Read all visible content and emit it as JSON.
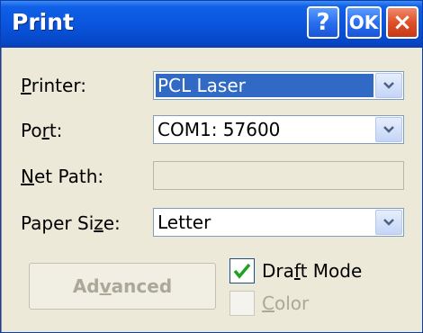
{
  "window": {
    "title": "Print"
  },
  "titlebar": {
    "help_label": "?",
    "ok_label": "OK",
    "close_label": "×"
  },
  "printer": {
    "label_before": "",
    "label_mnemonic": "P",
    "label_after": "rinter:",
    "value": "PCL Laser"
  },
  "port": {
    "label_before": "Po",
    "label_mnemonic": "r",
    "label_after": "t:",
    "value": "COM1: 57600"
  },
  "net_path": {
    "label_before": "",
    "label_mnemonic": "N",
    "label_after": "et Path:",
    "value": ""
  },
  "paper_size": {
    "label_before": "Paper Si",
    "label_mnemonic": "z",
    "label_after": "e:",
    "value": "Letter"
  },
  "advanced": {
    "before": "Ad",
    "mnemonic": "v",
    "after": "anced"
  },
  "draft_mode": {
    "before": "Dra",
    "mnemonic": "f",
    "after": "t Mode",
    "checked": true
  },
  "color": {
    "before": "",
    "mnemonic": "C",
    "after": "olor",
    "checked": false,
    "enabled": false
  },
  "colors": {
    "titlebar": "#0a55dd",
    "selection": "#316ac5",
    "dialog_bg": "#ece9d8"
  }
}
